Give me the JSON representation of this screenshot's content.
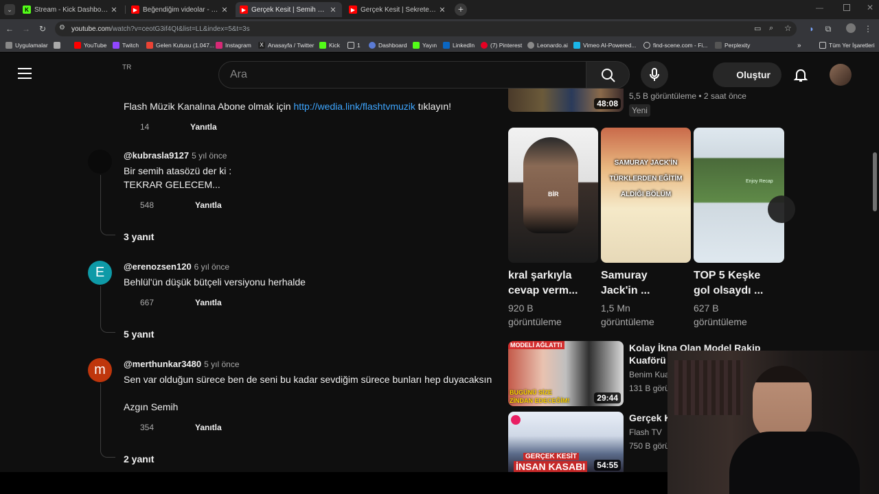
{
  "browser": {
    "tabs": [
      {
        "title": "Stream - Kick Dashboard",
        "icon": "kick-icon"
      },
      {
        "title": "Beğendiğim videolar - YouTube",
        "icon": "youtube-icon"
      },
      {
        "title": "Gerçek Kesit | Semih Ve Yenge...",
        "icon": "youtube-icon"
      },
      {
        "title": "Gerçek Kesit | Sekreter - YouTub",
        "icon": "youtube-icon"
      }
    ],
    "url_main": "youtube.com",
    "url_rest": "/watch?v=ceotG3if4QI&list=LL&index=5&t=3s",
    "bookmarks": [
      "Uygulamalar",
      "YouTube",
      "Twitch",
      "Gelen Kutusu (1.047...",
      "Instagram",
      "Anasayfa / Twitter",
      "Kick",
      "1",
      "Dashboard",
      "Yayın",
      "LinkedIn",
      "(7) Pinterest",
      "Leonardo.ai",
      "Vimeo AI-Powered...",
      "find-scene.com - Fi...",
      "Perplexity"
    ],
    "all_bookmarks": "Tüm Yer İşaretleri"
  },
  "yt": {
    "region": "TR",
    "search_placeholder": "Ara",
    "create_label": "Oluştur"
  },
  "comments": {
    "first": {
      "text_before": "Flash Müzik Kanalına Abone olmak için ",
      "link": "http://wedia.link/flashtvmuzik",
      "text_after": " tıklayın!",
      "likes": "14",
      "reply": "Yanıtla"
    },
    "items": [
      {
        "author": "@kubrasla9127",
        "time": "5 yıl önce",
        "line1": "Bir semih atasözü der ki :",
        "line2": "TEKRAR GELECEM...",
        "likes": "548",
        "reply": "Yanıtla",
        "replies": "3 yanıt",
        "avatar_letter": ""
      },
      {
        "author": "@erenozsen120",
        "time": "6 yıl önce",
        "line1": "Behlül'ün düşük bütçeli versiyonu herhalde",
        "line2": "",
        "likes": "667",
        "reply": "Yanıtla",
        "replies": "5 yanıt",
        "avatar_letter": "E"
      },
      {
        "author": "@merthunkar3480",
        "time": "5 yıl önce",
        "line1": "Sen var olduğun sürece ben de seni bu kadar sevdiğim sürece bunları hep duyacaksın",
        "line2": "Azgın Semih",
        "likes": "354",
        "reply": "Yanıtla",
        "replies": "2 yanıt",
        "avatar_letter": "m"
      }
    ]
  },
  "sidebar": {
    "top_video": {
      "duration": "48:08",
      "meta": "5,5 B görüntüleme • 2 saat önce",
      "badge": "Yeni"
    },
    "shorts": [
      {
        "title1": "kral şarkıyla",
        "title2": "cevap verm...",
        "views1": "920 B",
        "views2": "görüntüleme",
        "overlay": "BİR"
      },
      {
        "title1": "Samuray",
        "title2": "Jack'in ...",
        "views1": "1,5 Mn",
        "views2": "görüntüleme",
        "overlay": "SAMURAY JACK'İN TÜRKLERDEN EĞİTİM ALDIĞI BÖLÜM"
      },
      {
        "title1": "TOP 5 Keşke",
        "title2": "gol olsaydı ...",
        "views1": "627 B",
        "views2": "görüntüleme",
        "overlay": "Enjoy Recap"
      }
    ],
    "videos": [
      {
        "title": "Kolay İkna Olan Model Rakip Kuaförü S",
        "channel": "Benim Kua",
        "views": "131 B görü",
        "duration": "29:44",
        "overlay_top": "MODELİ AĞLATTI",
        "overlay_bottom1": "BUGÜNÜ SİZE",
        "overlay_bottom2": "ZİNDAN EDECEĞİM!"
      },
      {
        "title": "Gerçek K",
        "channel": "Flash TV",
        "views": "750 B görü",
        "duration": "54:55",
        "overlay_bottom1": "GERÇEK KESİT",
        "overlay_bottom2": "İNSAN KASABI"
      }
    ]
  },
  "colors": {
    "yt_bg": "#0f0f0f",
    "link": "#3ea6ff",
    "avatar_e": "#0e9aa7",
    "avatar_m": "#bf360c"
  }
}
